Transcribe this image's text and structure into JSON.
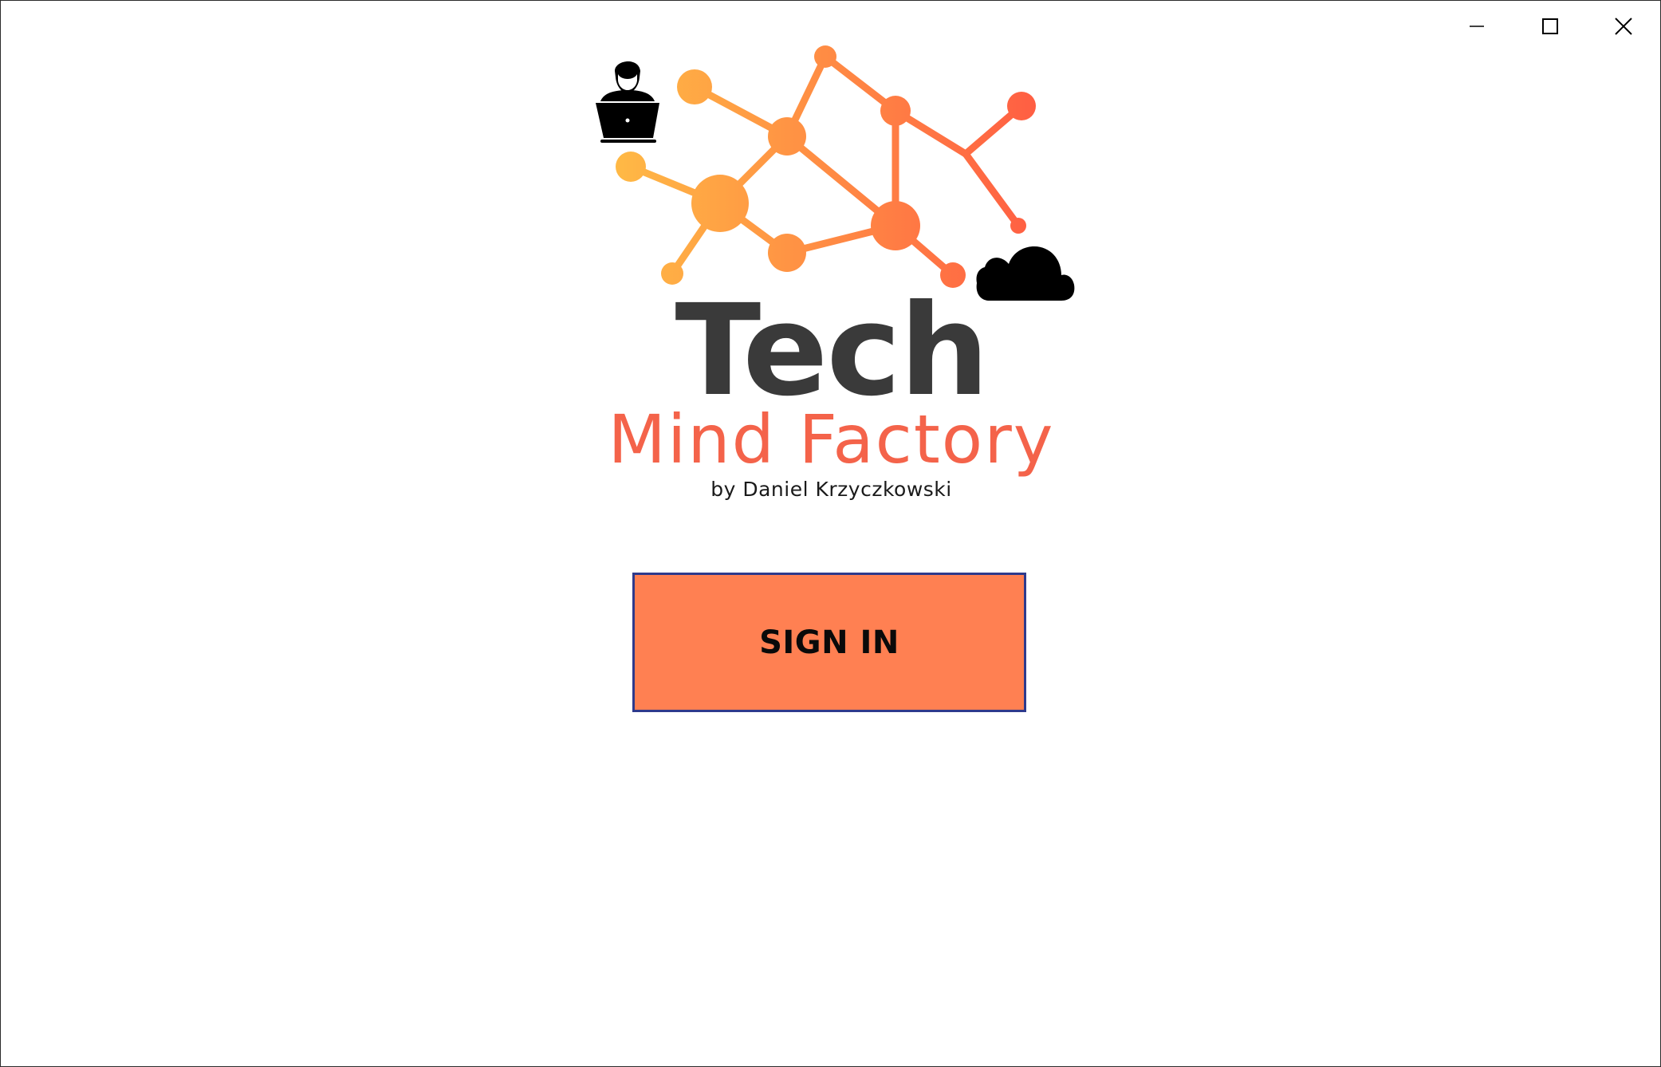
{
  "window": {
    "controls": {
      "minimize_icon": "minimize-icon",
      "maximize_icon": "maximize-icon",
      "close_icon": "close-icon"
    }
  },
  "logo": {
    "title": "Tech",
    "subtitle": "Mind Factory",
    "author": "by Daniel Krzyczkowski",
    "icons": [
      "developer-laptop-icon",
      "cloud-icon",
      "network-molecule-icon"
    ]
  },
  "colors": {
    "accent_orange": "#ff8052",
    "title_dark": "#3a3a3a",
    "subtitle_coral": "#f4634a",
    "button_border": "#2e3a8c",
    "gradient_start": "#ffbb45",
    "gradient_end": "#ff6347"
  },
  "actions": {
    "sign_in_label": "SIGN IN"
  }
}
